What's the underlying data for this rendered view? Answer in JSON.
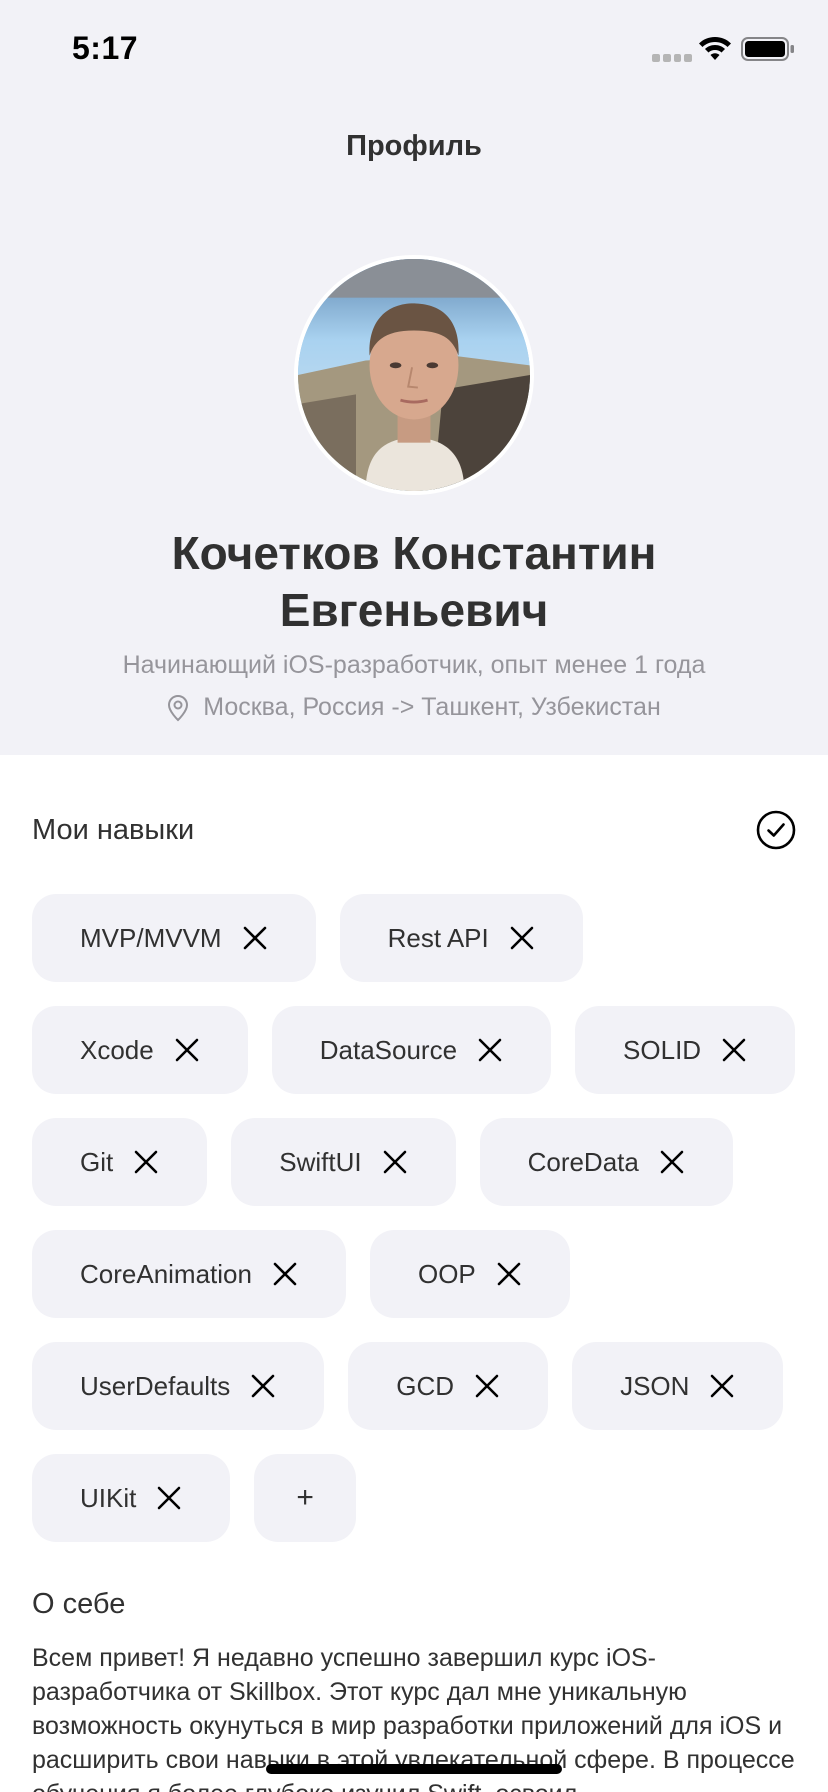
{
  "status_bar": {
    "time": "5:17"
  },
  "nav": {
    "title": "Профиль"
  },
  "profile": {
    "name": "Кочетков Константин Евгеньевич",
    "subtitle": "Начинающий iOS-разработчик, опыт менее 1 года",
    "location": "Москва, Россия -> Ташкент, Узбекистан"
  },
  "skills": {
    "title": "Мои навыки",
    "items": [
      "MVP/MVVM",
      "Rest API",
      "Xcode",
      "DataSource",
      "SOLID",
      "Git",
      "SwiftUI",
      "CoreData",
      "CoreAnimation",
      "OOP",
      "UserDefaults",
      "GCD",
      "JSON",
      "UIKit"
    ],
    "add_label": "+"
  },
  "about": {
    "title": "О себе",
    "text": "Всем привет! Я недавно успешно завершил курс iOS-разработчика от Skillbox. Этот курс дал мне уникальную возможность окунуться в мир разработки приложений для iOS и расширить свои навыки в этой увлекательной сфере. В процессе обучения я более глубоко изучил Swift, освоил"
  },
  "colors": {
    "header_background": "#f2f2f7",
    "chip_background": "#f2f2f7",
    "secondary_text": "#96959b",
    "primary_text": "#313131"
  },
  "icons": {
    "location": "location-pin-icon",
    "done": "checkmark-circle-icon",
    "remove": "close-icon"
  }
}
